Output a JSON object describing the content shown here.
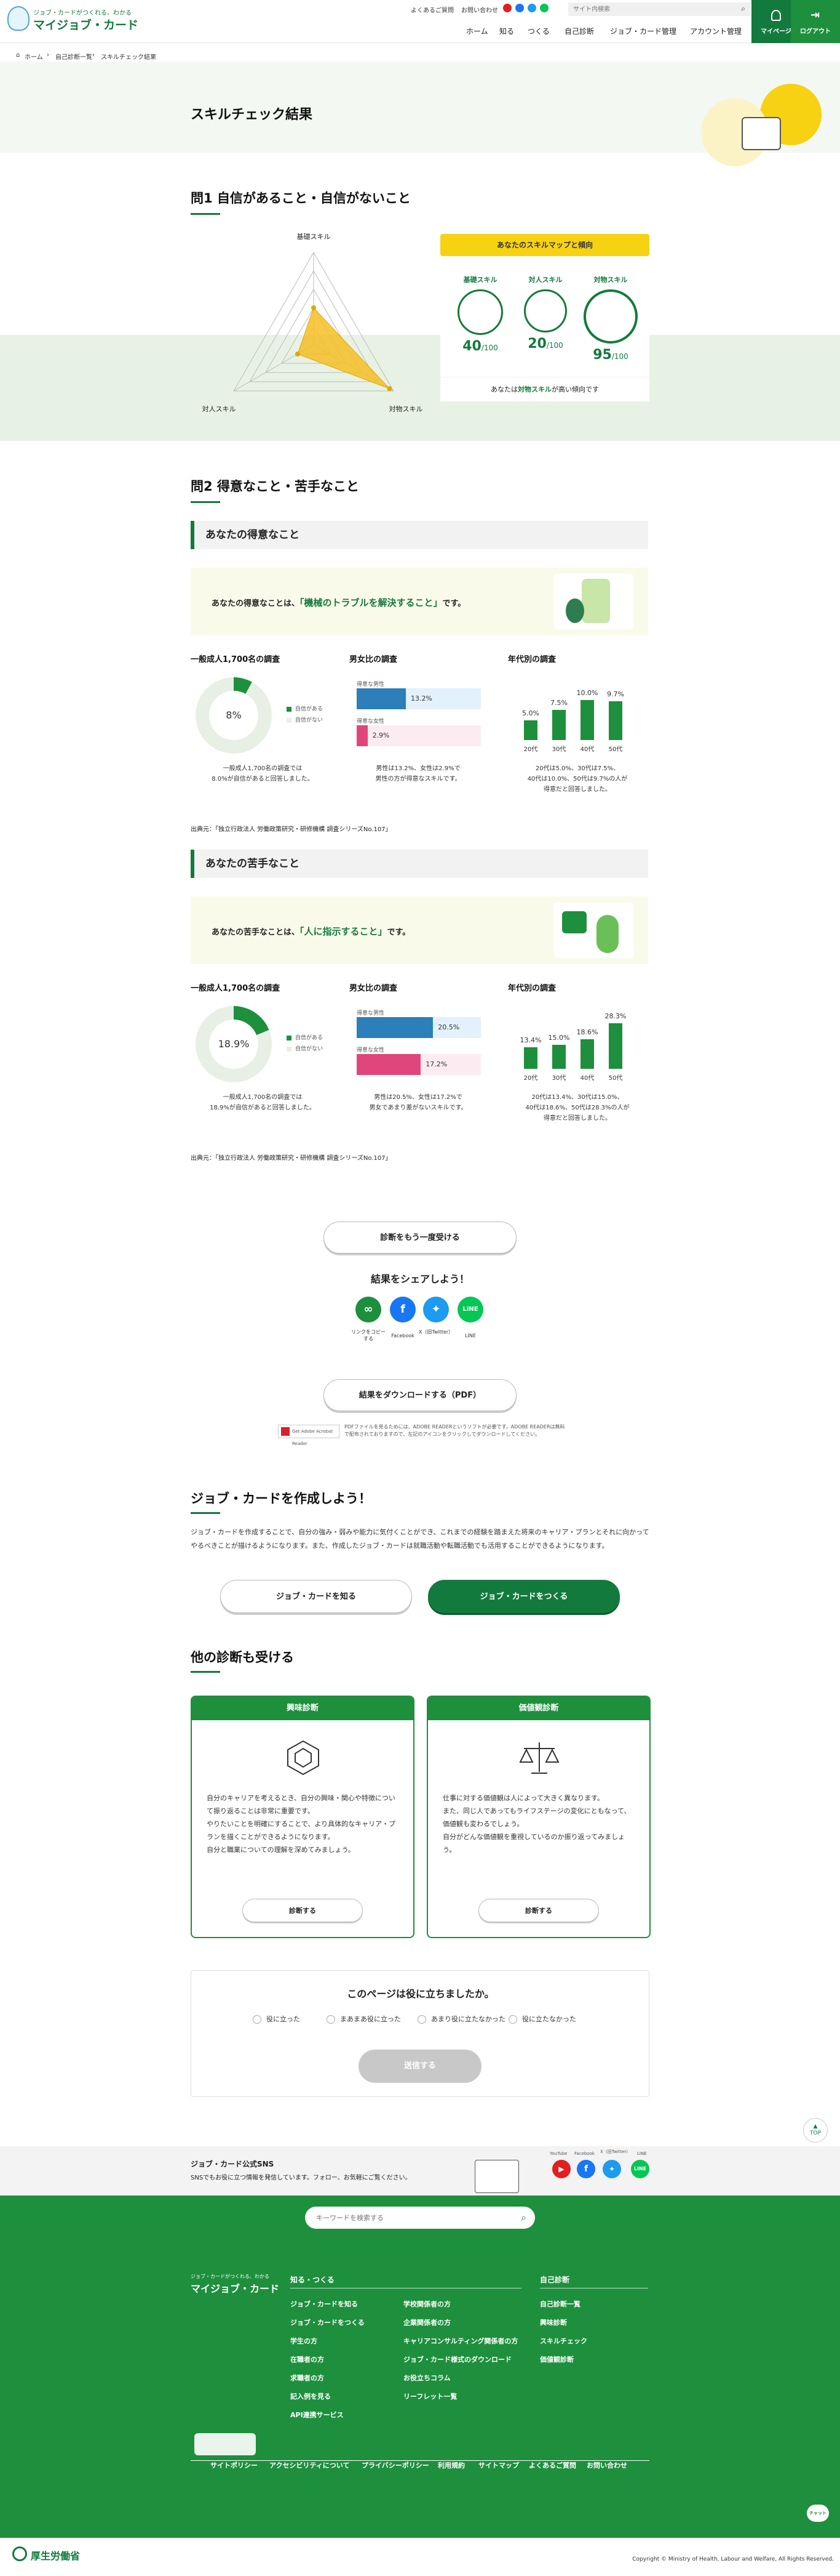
{
  "header": {
    "logo_tagline": "ジョブ・カードがつくれる、わかる",
    "logo_main": "マイジョブ・カード",
    "faq": "よくあるご質問",
    "contact": "お問い合わせ",
    "search_placeholder": "サイト内検索",
    "nav": [
      "ホーム",
      "知る",
      "つくる",
      "自己診断",
      "ジョブ・カード管理",
      "アカウント管理"
    ],
    "mypage": "マイページ",
    "logout": "ログアウト"
  },
  "breadcrumb": [
    "ホーム",
    "自己診断一覧",
    "スキルチェック結果"
  ],
  "page_title": "スキルチェック結果",
  "q1": {
    "title": "問1 自信があること・自信がないこと",
    "radar": {
      "axes": [
        "基礎スキル",
        "対人スキル",
        "対物スキル"
      ],
      "values": [
        40,
        20,
        95
      ],
      "max": 100
    },
    "panel_title": "あなたのスキルマップと傾向",
    "skills": [
      {
        "label": "基礎スキル",
        "value": "40",
        "unit": "/100"
      },
      {
        "label": "対人スキル",
        "value": "20",
        "unit": "/100"
      },
      {
        "label": "対物スキル",
        "value": "95",
        "unit": "/100"
      }
    ],
    "tendency_prefix": "あなたは",
    "tendency_highlight": "対物スキル",
    "tendency_suffix": "が高い傾向です"
  },
  "q2": {
    "title": "問2 得意なこと・苦手なこと",
    "good": {
      "heading": "あなたの得意なこと",
      "callout_prefix": "あなたの得意なことは、",
      "callout_highlight": "「機械のトラブルを解決すること」",
      "callout_suffix": "です。",
      "survey_h": "一般成人1,700名の調査",
      "donut_pct": "8%",
      "donut_value": 8,
      "legend_yes": "自信がある",
      "legend_no": "自信がない",
      "survey_note": "一般成人1,700名の調査では\n8.0%が自信があると回答しました。",
      "gender_h": "男女比の調査",
      "male_label": "得意な男性",
      "male_value": "13.2%",
      "male_num": 13.2,
      "female_label": "得意な女性",
      "female_value": "2.9%",
      "female_num": 2.9,
      "gender_note": "男性は13.2%、女性は2.9%で\n男性の方が得意なスキルです。",
      "age_h": "年代別の調査",
      "ages": [
        "20代",
        "30代",
        "40代",
        "50代"
      ],
      "age_values": [
        5.0,
        7.5,
        10.0,
        9.7
      ],
      "age_labels": [
        "5.0%",
        "7.5%",
        "10.0%",
        "9.7%"
      ],
      "age_note": "20代は5.0%、30代は7.5%、\n40代は10.0%、50代は9.7%の人が\n得意だと回答しました。",
      "source": "出典元：「独立行政法人 労働政策研究・研修機構 調査シリーズNo.107」"
    },
    "bad": {
      "heading": "あなたの苦手なこと",
      "callout_prefix": "あなたの苦手なことは、",
      "callout_highlight": "「人に指示すること」",
      "callout_suffix": "です。",
      "survey_h": "一般成人1,700名の調査",
      "donut_pct": "18.9%",
      "donut_value": 18.9,
      "legend_yes": "自信がある",
      "legend_no": "自信がない",
      "survey_note": "一般成人1,700名の調査では\n18.9%が自信があると回答しました。",
      "gender_h": "男女比の調査",
      "male_label": "得意な男性",
      "male_value": "20.5%",
      "male_num": 20.5,
      "female_label": "得意な女性",
      "female_value": "17.2%",
      "female_num": 17.2,
      "gender_note": "男性は20.5%、女性は17.2%で\n男女であまり差がないスキルです。",
      "age_h": "年代別の調査",
      "ages": [
        "20代",
        "30代",
        "40代",
        "50代"
      ],
      "age_values": [
        13.4,
        15.0,
        18.6,
        28.3
      ],
      "age_labels": [
        "13.4%",
        "15.0%",
        "18.6%",
        "28.3%"
      ],
      "age_note": "20代は13.4%、30代は15.0%、\n40代は18.6%、50代は28.3%の人が\n得意だと回答しました。",
      "source": "出典元：「独立行政法人 労働政策研究・研修機構 調査シリーズNo.107」"
    }
  },
  "actions": {
    "retry": "診断をもう一度受ける",
    "share_title": "結果をシェアしよう！",
    "share": [
      {
        "label": "リンクをコピーする",
        "icon": "link-icon",
        "color": "#1e8f3d"
      },
      {
        "label": "Facebook",
        "icon": "facebook-icon",
        "color": "#1877f2"
      },
      {
        "label": "X（旧Twitter）",
        "icon": "twitter-icon",
        "color": "#1d9bf0"
      },
      {
        "label": "LINE",
        "icon": "line-icon",
        "color": "#06c755"
      }
    ],
    "download": "結果をダウンロードする（PDF）",
    "pdf_badge": "Get Adobe Acrobat Reader",
    "pdf_note": "PDFファイルを見るためには、ADOBE READERというソフトが必要です。ADOBE READERは無料で配布されておりますので、左記のアイコンをクリックしてダウンロードしてください。"
  },
  "jobcard": {
    "title": "ジョブ・カードを作成しよう！",
    "text": "ジョブ・カードを作成することで、自分の強み・弱みや能力に気付くことができ、これまでの経験を踏まえた将来のキャリア・プランとそれに向かってやるべきことが描けるようになります。また、作成したジョブ・カードは就職活動や転職活動でも活用することができるようになります。",
    "know_btn": "ジョブ・カードを知る",
    "make_btn": "ジョブ・カードをつくる"
  },
  "other": {
    "title": "他の診断も受ける",
    "cards": [
      {
        "title": "興味診断",
        "icon": "hexagon-icon",
        "text": "自分のキャリアを考えるとき、自分の興味・関心や特徴について振り返ることは非常に重要です。\nやりたいことを明確にすることで、より具体的なキャリア・プランを描くことができるようになります。\n自分と職業についての理解を深めてみましょう。",
        "btn": "診断する"
      },
      {
        "title": "価値観診断",
        "icon": "scale-icon",
        "text": "仕事に対する価値観は人によって大きく異なります。\nまた、同じ人であってもライフステージの変化にともなって、価値観も変わるでしょう。\n自分がどんな価値観を重視しているのか振り返ってみましょう。",
        "btn": "診断する"
      }
    ]
  },
  "feedback": {
    "question": "このページは役に立ちましたか。",
    "options": [
      "役に立った",
      "まあまあ役に立った",
      "あまり役に立たなかった",
      "役に立たなかった"
    ],
    "send": "送信する"
  },
  "sns_band": {
    "title": "ジョブ・カード公式SNS",
    "text": "SNSでもお役に立つ情報を発信しています。フォロー、お気軽にご覧ください。",
    "labels": [
      "YouTube",
      "Facebook",
      "X（旧Twitter）",
      "LINE"
    ]
  },
  "pagetop": "TOP",
  "footer": {
    "search_placeholder": "キーワードを検索する",
    "logo_tagline": "ジョブ・カードがつくれる、わかる",
    "logo_main": "マイジョブ・カード",
    "col1_head": "知る・つくる",
    "col1": [
      "ジョブ・カードを知る",
      "ジョブ・カードをつくる",
      "学生の方",
      "在職者の方",
      "求職者の方",
      "記入例を見る",
      "API連携サービス"
    ],
    "col2": [
      "学校関係者の方",
      "企業関係者の方",
      "キャリアコンサルティング関係者の方",
      "ジョブ・カード様式のダウンロード",
      "お役立ちコラム",
      "リーフレット一覧"
    ],
    "col3_head": "自己診断",
    "col3": [
      "自己診断一覧",
      "興味診断",
      "スキルチェック",
      "価値観診断"
    ],
    "bottom": [
      "サイトポリシー",
      "アクセシビリティについて",
      "プライバシーポリシー",
      "利用規約",
      "サイトマップ",
      "よくあるご質問",
      "お問い合わせ"
    ],
    "mhlw": "厚生労働省",
    "copyright": "Copyright © Ministry of Health, Labour and Welfare, All Rights Reserved."
  },
  "chat": "チャット"
}
